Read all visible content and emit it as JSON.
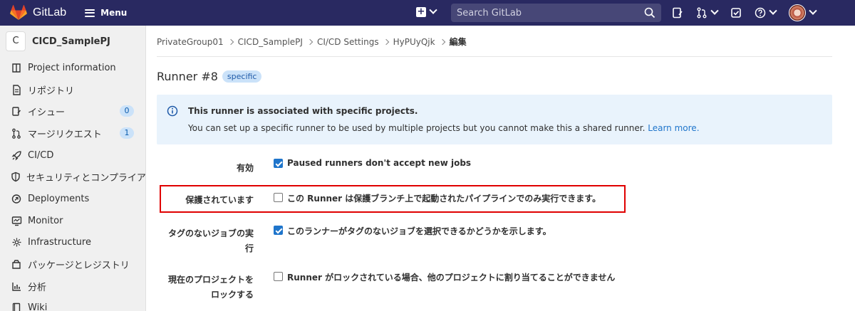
{
  "navbar": {
    "brand": "GitLab",
    "menu_label": "Menu",
    "search_placeholder": "Search GitLab"
  },
  "sidebar": {
    "project_initial": "C",
    "project_name": "CICD_SamplePJ",
    "items": [
      {
        "label": "Project information",
        "icon": "info-icon"
      },
      {
        "label": "リポジトリ",
        "icon": "document-icon"
      },
      {
        "label": "イシュー",
        "icon": "issues-icon",
        "badge": "0"
      },
      {
        "label": "マージリクエスト",
        "icon": "merge-request-icon",
        "badge": "1"
      },
      {
        "label": "CI/CD",
        "icon": "rocket-icon"
      },
      {
        "label": "セキュリティとコンプライアンス",
        "icon": "shield-icon"
      },
      {
        "label": "Deployments",
        "icon": "deployments-icon"
      },
      {
        "label": "Monitor",
        "icon": "monitor-icon"
      },
      {
        "label": "Infrastructure",
        "icon": "cloud-icon"
      },
      {
        "label": "パッケージとレジストリ",
        "icon": "package-icon"
      },
      {
        "label": "分析",
        "icon": "chart-icon"
      },
      {
        "label": "Wiki",
        "icon": "book-icon"
      }
    ]
  },
  "breadcrumb": [
    "PrivateGroup01",
    "CICD_SamplePJ",
    "CI/CD Settings",
    "HyPUyQjk",
    "編集"
  ],
  "page": {
    "title": "Runner #8",
    "tag": "specific"
  },
  "alert": {
    "title": "This runner is associated with specific projects.",
    "body": "You can set up a specific runner to be used by multiple projects but you cannot make this a shared runner.",
    "link": "Learn more."
  },
  "form": {
    "rows": [
      {
        "label": "有効",
        "text": "Paused runners don't accept new jobs",
        "checked": true
      },
      {
        "label": "保護されています",
        "text": "この Runner は保護ブランチ上で起動されたパイプラインでのみ実行できます。",
        "checked": false
      },
      {
        "label_line1": "タグのないジョブの実",
        "label_line2": "行",
        "text": "このランナーがタグのないジョブを選択できるかどうかを示します。",
        "checked": true
      },
      {
        "label_line1": "現在のプロジェクトを",
        "label_line2": "ロックする",
        "text": "Runner がロックされている場合、他のプロジェクトに割り当てることができません",
        "checked": false
      }
    ]
  },
  "colors": {
    "navbar": "#292961",
    "accent": "#1f75cb",
    "highlight": "#e00000",
    "alert_bg": "#e9f3fc"
  }
}
